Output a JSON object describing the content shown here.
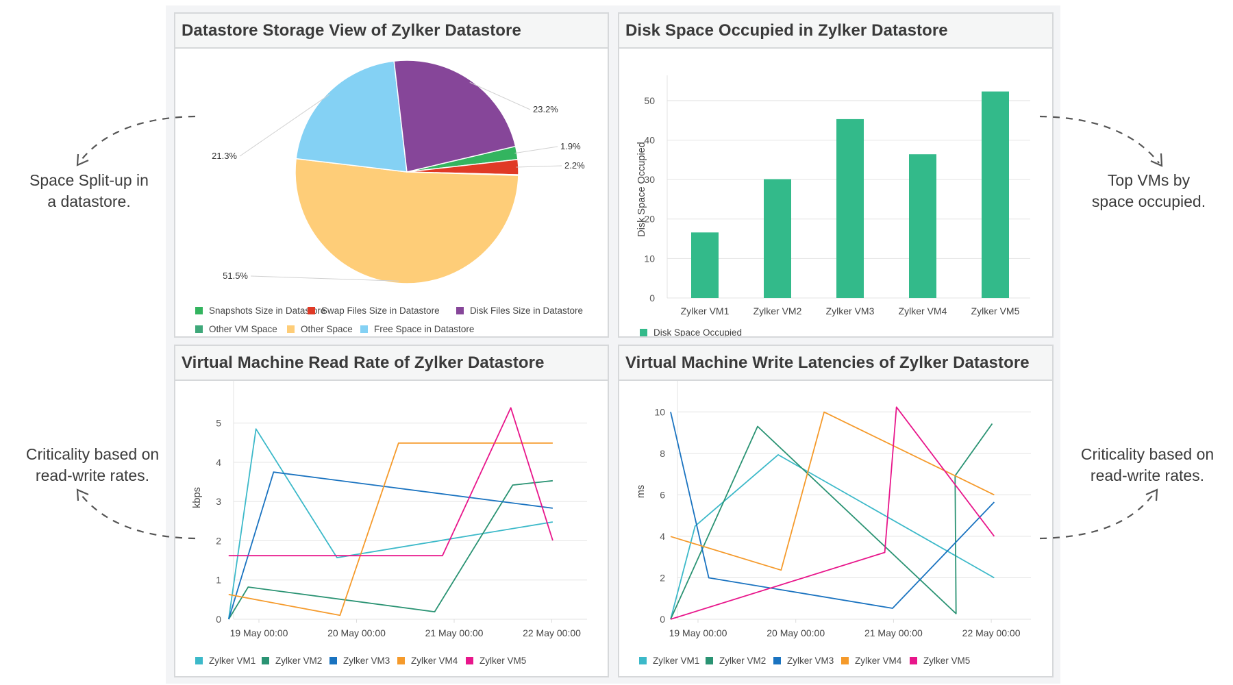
{
  "annotations": {
    "top_left": [
      "Space Split-up in",
      "a datastore."
    ],
    "top_right": [
      "Top VMs by",
      "space occupied."
    ],
    "bottom_left": [
      "Criticality based on",
      "read-write rates."
    ],
    "bottom_right": [
      "Criticality based on",
      "read-write rates."
    ]
  },
  "colors": {
    "vm1": "#3cb9c9",
    "vm2": "#2a9373",
    "vm3": "#1a73c0",
    "vm4": "#f59a2b",
    "vm5": "#e8168b",
    "bar": "#33ba8a"
  },
  "chart_data": [
    {
      "type": "pie",
      "title": "Datastore Storage View of Zylker Datastore",
      "slices": [
        {
          "label": "Snapshots Size in Datastore",
          "value": 1.9,
          "display": "1.9%",
          "color": "#33b45f"
        },
        {
          "label": "Swap Files Size in Datastore",
          "value": 2.2,
          "display": "2.2%",
          "color": "#e03a26"
        },
        {
          "label": "Other VM Space",
          "value": 0.1,
          "display": "",
          "color": "#3fa87a"
        },
        {
          "label": "Other Space",
          "value": 51.5,
          "display": "51.5%",
          "color": "#fecd78"
        },
        {
          "label": "Free Space in Datastore",
          "value": 21.3,
          "display": "21.3%",
          "color": "#84d1f4"
        },
        {
          "label": "Disk Files Size in Datastore",
          "value": 23.2,
          "display": "23.2%",
          "color": "#864699"
        }
      ],
      "legend": [
        {
          "label": "Snapshots Size in Datastore",
          "color": "#33b45f"
        },
        {
          "label": "Swap Files Size in Datastore",
          "color": "#e03a26"
        },
        {
          "label": "Disk Files Size in Datastore",
          "color": "#864699"
        },
        {
          "label": "Other VM Space",
          "color": "#3fa87a"
        },
        {
          "label": "Other Space",
          "color": "#fecd78"
        },
        {
          "label": "Free Space in Datastore",
          "color": "#84d1f4"
        }
      ],
      "legend_position": "bottom"
    },
    {
      "type": "bar",
      "title": "Disk Space Occupied in Zylker Datastore",
      "categories": [
        "Zylker VM1",
        "Zylker VM2",
        "Zylker VM3",
        "Zylker VM4",
        "Zylker VM5"
      ],
      "values": [
        16.6,
        30.1,
        45.3,
        36.4,
        52.3
      ],
      "series_name": "Disk Space Occupied",
      "xlabel": "",
      "ylabel": "Disk Space Occupied",
      "ylim": [
        0,
        55
      ],
      "yticks": [
        0,
        10,
        20,
        30,
        40,
        50
      ],
      "grid": true,
      "legend_position": "bottom-left"
    },
    {
      "type": "line",
      "title": "Virtual Machine Read Rate of Zylker Datastore",
      "xlabel": "",
      "ylabel": "kbps",
      "x_unit": "days since 19 May 00:00",
      "xlim": [
        -0.31,
        3.3
      ],
      "xticks": [
        0,
        1,
        2,
        3
      ],
      "xtick_labels": [
        "19 May 00:00",
        "20 May 00:00",
        "21 May 00:00",
        "22 May 00:00"
      ],
      "ylim": [
        0,
        5.5
      ],
      "yticks": [
        0,
        1,
        2,
        3,
        4,
        5
      ],
      "grid": true,
      "legend_position": "bottom-left",
      "series": [
        {
          "name": "Zylker VM1",
          "x": [
            -0.31,
            -0.03,
            0.8,
            3.01
          ],
          "y": [
            0,
            4.85,
            1.57,
            2.48
          ]
        },
        {
          "name": "Zylker VM2",
          "x": [
            -0.31,
            -0.11,
            1.8,
            2.6,
            3.01
          ],
          "y": [
            0,
            0.82,
            0.19,
            3.42,
            3.53
          ]
        },
        {
          "name": "Zylker VM3",
          "x": [
            -0.31,
            0.15,
            3.01
          ],
          "y": [
            0,
            3.75,
            2.83
          ]
        },
        {
          "name": "Zylker VM4",
          "x": [
            -0.31,
            0.83,
            1.43,
            3.01
          ],
          "y": [
            0.63,
            0.1,
            4.49,
            4.49
          ]
        },
        {
          "name": "Zylker VM5",
          "x": [
            -0.31,
            1.88,
            2.58,
            3.01
          ],
          "y": [
            1.62,
            1.62,
            5.39,
            2.01
          ]
        }
      ]
    },
    {
      "type": "line",
      "title": "Virtual Machine Write Latencies of Zylker Datastore",
      "xlabel": "",
      "ylabel": "ms",
      "x_unit": "days since 19 May 00:00",
      "xlim": [
        -0.28,
        3.3
      ],
      "xticks": [
        0,
        1,
        2,
        3
      ],
      "xtick_labels": [
        "19 May 00:00",
        "20 May 00:00",
        "21 May 00:00",
        "22 May 00:00"
      ],
      "ylim": [
        0,
        11
      ],
      "yticks": [
        0,
        2,
        4,
        6,
        8,
        10
      ],
      "grid": true,
      "legend_position": "bottom-left",
      "series": [
        {
          "name": "Zylker VM1",
          "x": [
            -0.28,
            -0.03,
            0.82,
            3.03
          ],
          "y": [
            0,
            4.49,
            7.93,
            2.0
          ]
        },
        {
          "name": "Zylker VM2",
          "x": [
            -0.28,
            0.61,
            2.64,
            2.63,
            3.01
          ],
          "y": [
            0,
            9.3,
            0.27,
            6.92,
            9.43
          ]
        },
        {
          "name": "Zylker VM3",
          "x": [
            -0.28,
            0.11,
            1.99,
            3.03
          ],
          "y": [
            10,
            2.0,
            0.53,
            5.65
          ]
        },
        {
          "name": "Zylker VM4",
          "x": [
            -0.28,
            0.85,
            1.29,
            3.03
          ],
          "y": [
            3.99,
            2.37,
            9.99,
            6.0
          ]
        },
        {
          "name": "Zylker VM5",
          "x": [
            -0.28,
            1.91,
            2.03,
            3.03
          ],
          "y": [
            0,
            3.22,
            10.23,
            4.0
          ]
        }
      ]
    }
  ]
}
